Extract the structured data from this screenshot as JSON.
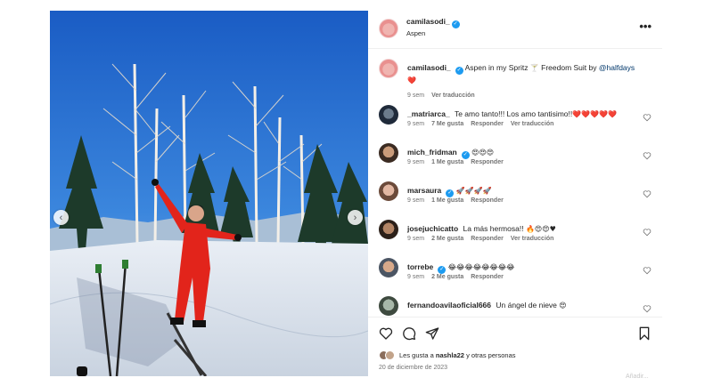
{
  "colors": {
    "verified": "#1d9bf0",
    "heart": "#ed4956",
    "link": "#00376b",
    "muted": "#737373"
  },
  "post": {
    "username": "camilasodi_",
    "location": "Aspen",
    "more_icon": "more-horizontal-icon",
    "caption": {
      "username": "camilasodi_",
      "text_before": "Aspen in my Spritz ",
      "emoji_mid": "🍸",
      "text_after": " Freedom Suit by ",
      "mention": "@halfdays",
      "emoji_end": "❤️",
      "time": "9 sem",
      "translate": "Ver traducción"
    }
  },
  "comments": [
    {
      "username": "_matriarca_",
      "verified": false,
      "text": "Te amo tanto!!! Los amo tantisimo!!",
      "emoji": "❤️❤️❤️❤️❤️",
      "time": "9 sem",
      "likes": "7 Me gusta",
      "reply": "Responder",
      "translate": "Ver traducción"
    },
    {
      "username": "mich_fridman",
      "verified": true,
      "text": "",
      "emoji": "😍😍😍",
      "time": "9 sem",
      "likes": "1 Me gusta",
      "reply": "Responder",
      "translate": ""
    },
    {
      "username": "marsaura",
      "verified": true,
      "text": "",
      "emoji": "🚀🚀🚀🚀",
      "time": "9 sem",
      "likes": "1 Me gusta",
      "reply": "Responder",
      "translate": ""
    },
    {
      "username": "josejuchicatto",
      "verified": false,
      "text": "La más hermosa!!",
      "emoji": "🔥😍😍♥",
      "time": "9 sem",
      "likes": "2 Me gusta",
      "reply": "Responder",
      "translate": "Ver traducción"
    },
    {
      "username": "torrebe",
      "verified": true,
      "text": "",
      "emoji": "😂😂😂😂😂😂😂😂",
      "time": "9 sem",
      "likes": "2 Me gusta",
      "reply": "Responder",
      "translate": ""
    },
    {
      "username": "fernandoavilaoficial666",
      "verified": false,
      "text": "Un ángel de nieve",
      "emoji": "😍",
      "time": "",
      "likes": "",
      "reply": "",
      "translate": ""
    }
  ],
  "actions": {
    "like_icon": "heart-outline-icon",
    "comment_icon": "comment-icon",
    "share_icon": "send-icon",
    "save_icon": "bookmark-icon",
    "likes_prefix": "Les gusta a ",
    "likes_user": "nashla22",
    "likes_suffix": " y otras personas",
    "date": "20 de diciembre de 2023"
  },
  "faded_footer": "Añadir..."
}
